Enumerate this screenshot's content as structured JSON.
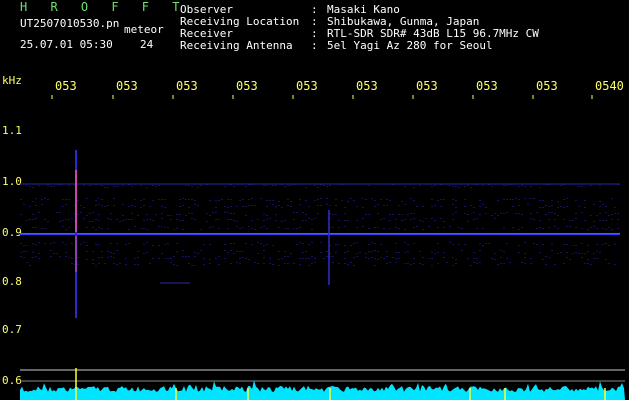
{
  "header": {
    "title": "H R O F F T",
    "filename": "UT2507010530.pn",
    "detect_label": "meteor",
    "datetime": "25.07.01 05:30",
    "count": "24"
  },
  "info": [
    {
      "key": "Observer",
      "value": "Masaki Kano"
    },
    {
      "key": "Receiving Location",
      "value": "Shibukawa, Gunma, Japan"
    },
    {
      "key": "Receiver",
      "value": "RTL-SDR SDR# 43dB L15 96.7MHz CW"
    },
    {
      "key": "Receiving Antenna",
      "value": "5el Yagi Az 280 for Seoul"
    }
  ],
  "axis": {
    "unit": "kHz",
    "time_ticks": [
      "053",
      "053",
      "053",
      "053",
      "053",
      "053",
      "053",
      "053",
      "053",
      "0540"
    ],
    "freq_ticks": [
      "1.1",
      "1.0",
      "0.9",
      "0.8",
      "0.7",
      "0.6"
    ]
  },
  "colors": {
    "axis_text": "#ffff66",
    "title": "#6ee06e",
    "signal": "#3a3aff",
    "meteor": "#ff4fa0",
    "noise_floor": "#00e5ff"
  }
}
